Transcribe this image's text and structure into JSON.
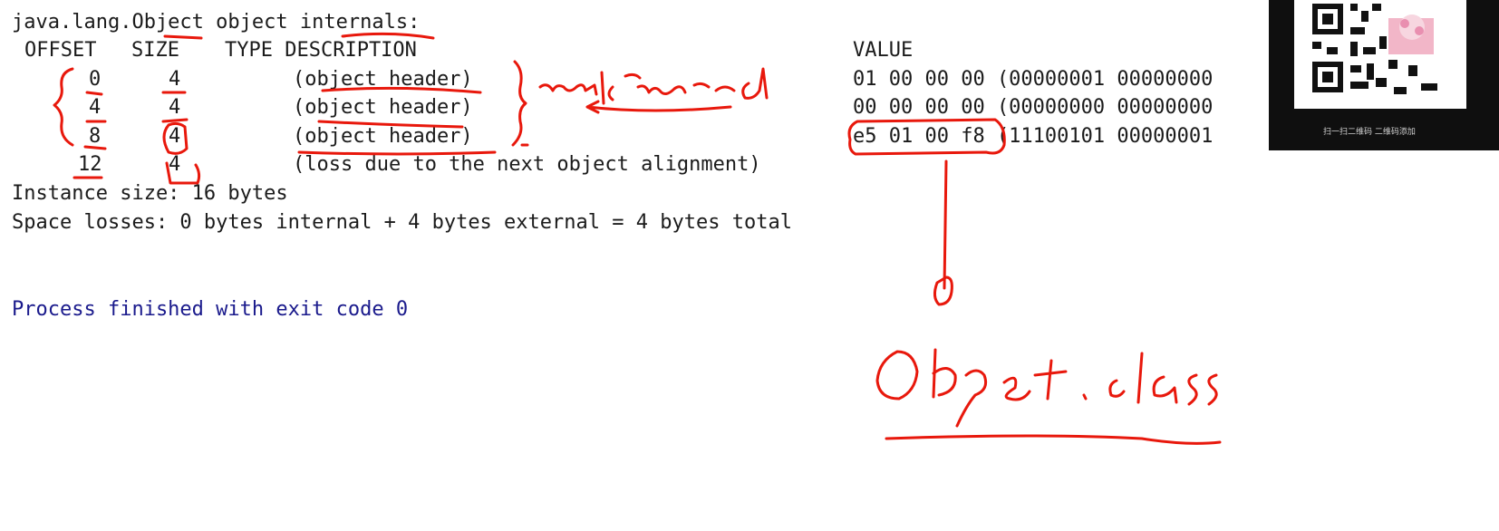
{
  "console": {
    "top_cut_line": "",
    "header_line": "java.lang.Object object internals:",
    "columns": {
      "offset": "OFFSET",
      "size": "SIZE",
      "type_description": "TYPE DESCRIPTION",
      "value": "VALUE"
    },
    "rows": [
      {
        "offset": "0",
        "size": "4",
        "description": "(object header)",
        "value": "01 00 00 00 (00000001 00000000"
      },
      {
        "offset": "4",
        "size": "4",
        "description": "(object header)",
        "value": "00 00 00 00 (00000000 00000000"
      },
      {
        "offset": "8",
        "size": "4",
        "description": "(object header)",
        "value": "e5 01 00 f8 (11100101 00000001"
      },
      {
        "offset": "12",
        "size": "4",
        "description": "(loss due to the next object alignment)",
        "value": ""
      }
    ],
    "instance_size": "Instance size: 16 bytes",
    "space_losses": "Space losses: 0 bytes internal + 4 bytes external = 4 bytes total",
    "process_line": "Process finished with exit code 0"
  },
  "handwriting": {
    "markword": "markword",
    "object_class": "Object.class"
  },
  "colors": {
    "annotation": "#e8180c",
    "process_text": "#1a1a8c",
    "console_text": "#1b1b1b"
  }
}
